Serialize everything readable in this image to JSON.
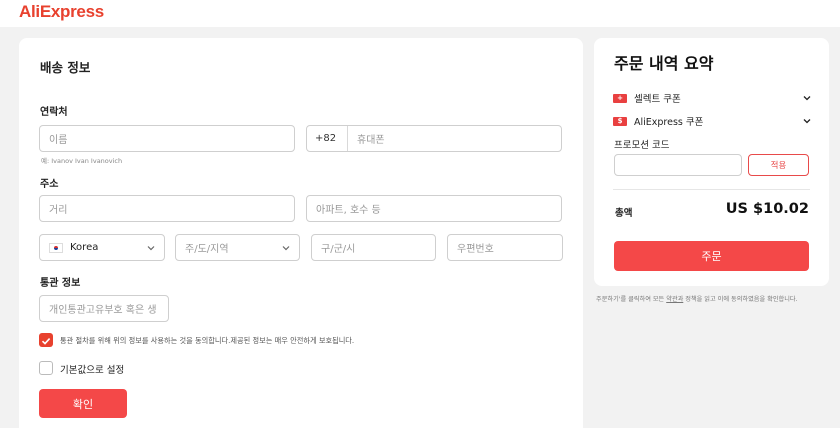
{
  "brand": {
    "logo_text": "AliExpress",
    "color": "#e8412e"
  },
  "shipping": {
    "title": "배송 정보",
    "contact_label": "연락처",
    "name_placeholder": "이름",
    "name_hint": "예: Ivanov Ivan Ivanovich",
    "phone_prefix": "+82",
    "phone_placeholder": "휴대폰",
    "address_label": "주소",
    "street_placeholder": "거리",
    "apt_placeholder": "아파트, 호수 등",
    "country_value": "Korea",
    "state_placeholder": "주/도/지역",
    "city_placeholder": "구/군/시",
    "zip_placeholder": "우편번호",
    "customs_label": "통관 정보",
    "customs_placeholder": "개인통관고유부호 혹은 생",
    "consent_text": "통관 절차를 위해 위의 정보를 사용하는 것을 동의합니다.제공된 정보는 매우 안전하게 보호됩니다.",
    "consent_checked": true,
    "default_text": "기본값으로 설정",
    "default_checked": false,
    "confirm_label": "확인"
  },
  "summary": {
    "title": "주문 내역 요약",
    "coupon1_label": "셀렉트 쿠폰",
    "coupon2_label": "AliExpress 쿠폰",
    "promo_label": "프로모션 코드",
    "apply_label": "적용",
    "total_label": "총액",
    "total_value": "US $10.02",
    "order_label": "주문"
  },
  "footnote": {
    "before": "주문하기'를 클릭하여 모든 ",
    "link": "약관과",
    "after": " 정책을 읽고 이에 동의하였음을 확인합니다."
  },
  "colors": {
    "accent": "#f44848",
    "brand": "#e8412e",
    "page_bg": "#f2f2f2"
  }
}
